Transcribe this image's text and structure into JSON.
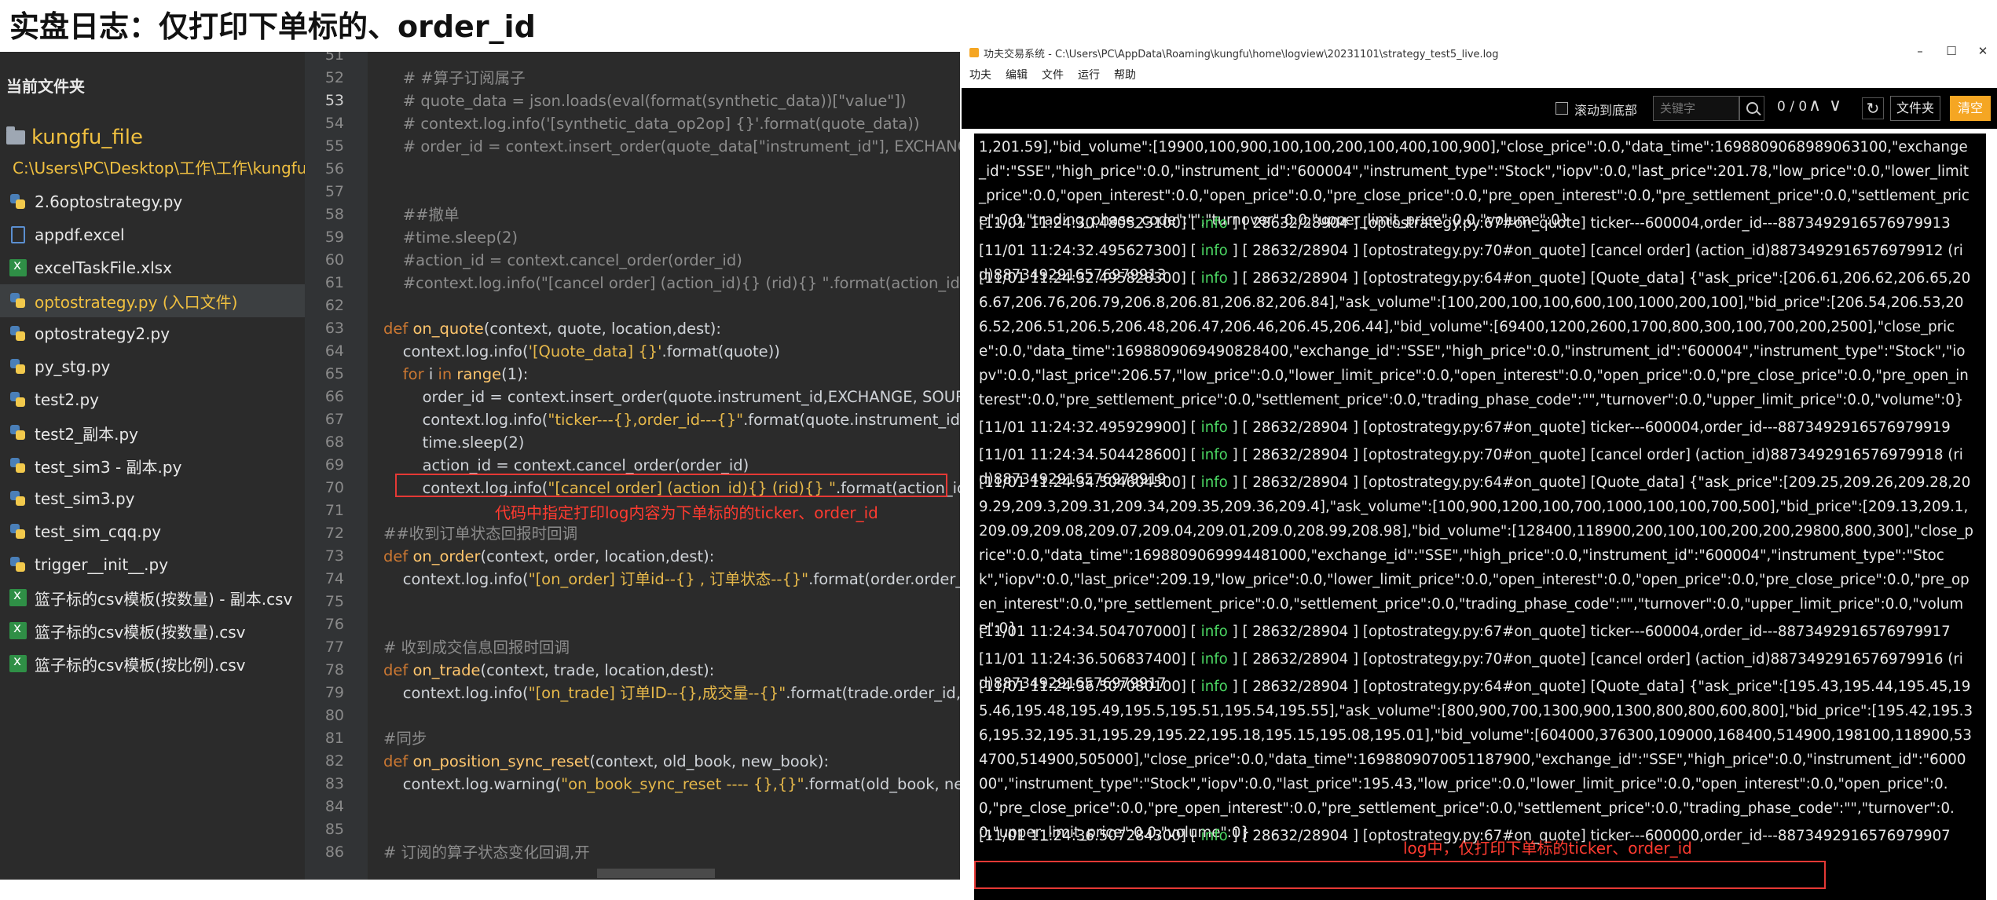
{
  "page_title": "实盘日志：仅打印下单标的、order_id",
  "explorer": {
    "title": "当前文件夹",
    "root_folder": "kungfu_file",
    "root_path": "C:\\Users\\PC\\Desktop\\工作\\工作\\kungfu_file",
    "files": [
      {
        "name": "2.6optostrategy.py",
        "icon": "python-file-icon"
      },
      {
        "name": "appdf.excel",
        "icon": "document-icon"
      },
      {
        "name": "excelTaskFile.xlsx",
        "icon": "excel-icon"
      },
      {
        "name": "optostrategy.py (入口文件)",
        "icon": "python-file-icon",
        "active": true
      },
      {
        "name": "optostrategy2.py",
        "icon": "python-file-icon"
      },
      {
        "name": "py_stg.py",
        "icon": "python-file-icon"
      },
      {
        "name": "test2.py",
        "icon": "python-file-icon"
      },
      {
        "name": "test2_副本.py",
        "icon": "python-file-icon"
      },
      {
        "name": "test_sim3 - 副本.py",
        "icon": "python-file-icon"
      },
      {
        "name": "test_sim3.py",
        "icon": "python-file-icon"
      },
      {
        "name": "test_sim_cqq.py",
        "icon": "python-file-icon"
      },
      {
        "name": "trigger__init__.py",
        "icon": "python-file-icon"
      },
      {
        "name": "篮子标的csv模板(按数量) - 副本.csv",
        "icon": "excel-icon"
      },
      {
        "name": "篮子标的csv模板(按数量).csv",
        "icon": "excel-icon"
      },
      {
        "name": "篮子标的csv模板(按比例).csv",
        "icon": "excel-icon"
      }
    ]
  },
  "editor": {
    "current_line": 53,
    "lines": [
      {
        "n": 51,
        "text": ""
      },
      {
        "n": 52,
        "text": "    # #算子订阅属子",
        "cls": "cm"
      },
      {
        "n": 53,
        "text": "    # quote_data = json.loads(eval(format(synthetic_data))[\"value\"])",
        "cls": "cm"
      },
      {
        "n": 54,
        "text": "    # context.log.info('[synthetic_data_op2op] {}'.format(quote_data))",
        "cls": "cm"
      },
      {
        "n": 55,
        "text": "    # order_id = context.insert_order(quote_data[\"instrument_id\"], EXCHANGE,SOURCE, ACCOUNT,",
        "cls": "cm"
      },
      {
        "n": 56,
        "text": ""
      },
      {
        "n": 57,
        "text": ""
      },
      {
        "n": 58,
        "text": "    ##撤单",
        "cls": "cm"
      },
      {
        "n": 59,
        "text": "    #time.sleep(2)",
        "cls": "cm"
      },
      {
        "n": 60,
        "text": "    #action_id = context.cancel_order(order_id)",
        "cls": "cm"
      },
      {
        "n": 61,
        "text": "    #context.log.info(\"[cancel order] (action_id){} (rid){} \".format(action_id, order_id))",
        "cls": "cm"
      },
      {
        "n": 62,
        "text": ""
      },
      {
        "n": 63,
        "kw": "def ",
        "fn": "on_quote",
        "rest": "(context, quote, location,dest):"
      },
      {
        "n": 64,
        "pre": "    context.log.info(",
        "str": "'[Quote_data] {}'",
        "post": ".format(quote))"
      },
      {
        "n": 65,
        "kw": "    for ",
        "rest": "i ",
        "kw2": "in ",
        "fn": "range",
        "post": "(1):"
      },
      {
        "n": 66,
        "text": "        order_id = context.insert_order(quote.instrument_id,EXCHANGE, SOURCE, ACCOUNT,"
      },
      {
        "n": 67,
        "pre": "        context.log.info(",
        "str": "\"ticker---{},order_id---{}\"",
        "post": ".format(quote.instrument_id, order_id))"
      },
      {
        "n": 68,
        "text": "        time.sleep(2)"
      },
      {
        "n": 69,
        "text": "        action_id = context.cancel_order(order_id)"
      },
      {
        "n": 70,
        "pre": "        context.log.info(",
        "str": "\"[cancel order] (action_id){} (rid){} \"",
        "post": ".format(action_id, order_id))"
      },
      {
        "n": 71,
        "text": ""
      },
      {
        "n": 72,
        "text": "##收到订单状态回报时回调",
        "cls": "cm"
      },
      {
        "n": 73,
        "kw": "def ",
        "fn": "on_order",
        "rest": "(context, order, location,dest):"
      },
      {
        "n": 74,
        "pre": "    context.log.info(",
        "str": "\"[on_order] 订单id--{} , 订单状态--{}\"",
        "post": ".format(order.order_id, order.status"
      },
      {
        "n": 75,
        "text": ""
      },
      {
        "n": 76,
        "text": ""
      },
      {
        "n": 77,
        "text": "# 收到成交信息回报时回调",
        "cls": "cm"
      },
      {
        "n": 78,
        "kw": "def ",
        "fn": "on_trade",
        "rest": "(context, trade, location,dest):"
      },
      {
        "n": 79,
        "pre": "    context.log.info(",
        "str": "\"[on_trade] 订单ID--{},成交量--{}\"",
        "post": ".format(trade.order_id, trade.volume))"
      },
      {
        "n": 80,
        "text": ""
      },
      {
        "n": 81,
        "text": "#同步",
        "cls": "cm"
      },
      {
        "n": 82,
        "kw": "def ",
        "fn": "on_position_sync_reset",
        "rest": "(context, old_book, new_book):"
      },
      {
        "n": 83,
        "pre": "    context.log.warning(",
        "str": "\"on_book_sync_reset ---- {},{}\"",
        "post": ".format(old_book, new_book))"
      },
      {
        "n": 84,
        "text": ""
      },
      {
        "n": 85,
        "text": ""
      },
      {
        "n": 86,
        "text": "# 订阅的算子状态变化回调,开",
        "cls": "cm"
      }
    ],
    "annotation": "代码中指定打印log内容为下单标的的ticker、order_id"
  },
  "logwin": {
    "title": "功夫交易系统 - C:\\Users\\PC\\AppData\\Roaming\\kungfu\\home\\logview\\20231101\\strategy_test5_live.log",
    "window_controls": {
      "minimize": "–",
      "maximize": "☐",
      "close": "✕"
    },
    "menu": [
      "功夫",
      "编辑",
      "文件",
      "运行",
      "帮助"
    ],
    "toolbar": {
      "scroll_bottom_label": "滚动到底部",
      "search_placeholder": "关键字",
      "count": "0 / 0",
      "up": "∧",
      "down": "∨",
      "refresh": "↻",
      "folder_button": "文件夹",
      "clear_button": "清空"
    },
    "entries": [
      {
        "text": "1,201.59],\"bid_volume\":[19900,100,900,100,100,200,100,400,100,900],\"close_price\":0.0,\"data_time\":1698809068989063100,\"exchange_id\":\"SSE\",\"high_price\":0.0,\"instrument_id\":\"600004\",\"instrument_type\":\"Stock\",\"iopv\":0.0,\"last_price\":201.78,\"low_price\":0.0,\"lower_limit_price\":0.0,\"open_interest\":0.0,\"open_price\":0.0,\"pre_close_price\":0.0,\"pre_open_interest\":0.0,\"pre_settlement_price\":0.0,\"settlement_price\":0.0,\"trading_phase_code\":\"\",\"turnover\":0.0,\"upper_limit_price\":0.0,\"volume\":0}"
      },
      {
        "ts": "[11/01 11:24:30.480523100]",
        "level": "info",
        "text": "[ 28632/28904 ] [optostrategy.py:67#on_quote] ticker---600004,order_id---8873492916576979913"
      },
      {
        "ts": "[11/01 11:24:32.495627300]",
        "level": "info",
        "text": "[ 28632/28904 ] [optostrategy.py:70#on_quote] [cancel order] (action_id)8873492916576979912 (rid)8873492916576979913"
      },
      {
        "ts": "[11/01 11:24:32.495828300]",
        "level": "info",
        "text": "[ 28632/28904 ] [optostrategy.py:64#on_quote] [Quote_data] {\"ask_price\":[206.61,206.62,206.65,206.67,206.76,206.79,206.8,206.81,206.82,206.84],\"ask_volume\":[100,200,100,100,600,100,1000,200,100],\"bid_price\":[206.54,206.53,206.52,206.51,206.5,206.48,206.47,206.46,206.45,206.44],\"bid_volume\":[69400,1200,2600,1700,800,300,100,700,200,2500],\"close_price\":0.0,\"data_time\":1698809069490828400,\"exchange_id\":\"SSE\",\"high_price\":0.0,\"instrument_id\":\"600004\",\"instrument_type\":\"Stock\",\"iopv\":0.0,\"last_price\":206.57,\"low_price\":0.0,\"lower_limit_price\":0.0,\"open_interest\":0.0,\"open_price\":0.0,\"pre_close_price\":0.0,\"pre_open_interest\":0.0,\"pre_settlement_price\":0.0,\"settlement_price\":0.0,\"trading_phase_code\":\"\",\"turnover\":0.0,\"upper_limit_price\":0.0,\"volume\":0}"
      },
      {
        "ts": "[11/01 11:24:32.495929900]",
        "level": "info",
        "text": "[ 28632/28904 ] [optostrategy.py:67#on_quote] ticker---600004,order_id---8873492916576979919"
      },
      {
        "ts": "[11/01 11:24:34.504428600]",
        "level": "info",
        "text": "[ 28632/28904 ] [optostrategy.py:70#on_quote] [cancel order] (action_id)8873492916576979918 (rid)8873492916576979919"
      },
      {
        "ts": "[11/01 11:24:34.504604500]",
        "level": "info",
        "text": "[ 28632/28904 ] [optostrategy.py:64#on_quote] [Quote_data] {\"ask_price\":[209.25,209.26,209.28,209.29,209.3,209.31,209.34,209.35,209.36,209.4],\"ask_volume\":[100,900,1200,100,700,1000,100,100,700,500],\"bid_price\":[209.13,209.1,209.09,209.08,209.07,209.04,209.01,209.0,208.99,208.98],\"bid_volume\":[128400,118900,200,100,100,200,200,29800,800,300],\"close_price\":0.0,\"data_time\":1698809069994481000,\"exchange_id\":\"SSE\",\"high_price\":0.0,\"instrument_id\":\"600004\",\"instrument_type\":\"Stock\",\"iopv\":0.0,\"last_price\":209.19,\"low_price\":0.0,\"lower_limit_price\":0.0,\"open_interest\":0.0,\"open_price\":0.0,\"pre_close_price\":0.0,\"pre_open_interest\":0.0,\"pre_settlement_price\":0.0,\"settlement_price\":0.0,\"trading_phase_code\":\"\",\"turnover\":0.0,\"upper_limit_price\":0.0,\"volume\":0}"
      },
      {
        "ts": "[11/01 11:24:34.504707000]",
        "level": "info",
        "text": "[ 28632/28904 ] [optostrategy.py:67#on_quote] ticker---600004,order_id---8873492916576979917"
      },
      {
        "ts": "[11/01 11:24:36.506837400]",
        "level": "info",
        "text": "[ 28632/28904 ] [optostrategy.py:70#on_quote] [cancel order] (action_id)8873492916576979916 (rid)8873492916576979917"
      },
      {
        "ts": "[11/01 11:24:36.507080100]",
        "level": "info",
        "text": "[ 28632/28904 ] [optostrategy.py:64#on_quote] [Quote_data] {\"ask_price\":[195.43,195.44,195.45,195.46,195.48,195.49,195.5,195.51,195.54,195.55],\"ask_volume\":[800,900,700,1300,900,1300,800,800,600,800],\"bid_price\":[195.42,195.36,195.32,195.31,195.29,195.22,195.18,195.15,195.08,195.01],\"bid_volume\":[604000,376300,109000,168400,514900,198100,118900,534700,514900,505000],\"close_price\":0.0,\"data_time\":1698809070051187900,\"exchange_id\":\"SSE\",\"high_price\":0.0,\"instrument_id\":\"600000\",\"instrument_type\":\"Stock\",\"iopv\":0.0,\"last_price\":195.43,\"low_price\":0.0,\"lower_limit_price\":0.0,\"open_interest\":0.0,\"open_price\":0.0,\"pre_close_price\":0.0,\"pre_open_interest\":0.0,\"pre_settlement_price\":0.0,\"settlement_price\":0.0,\"trading_phase_code\":\"\",\"turnover\":0.0,\"upper_limit_price\":0.0,\"volume\":0}"
      },
      {
        "ts": "[11/01 11:24:36.507284300]",
        "level": "info",
        "text": "[ 28632/28904 ] [optostrategy.py:67#on_quote] ticker---600000,order_id---8873492916576979907"
      }
    ],
    "annotation": "log中，仅打印下单标的ticker、order_id"
  }
}
